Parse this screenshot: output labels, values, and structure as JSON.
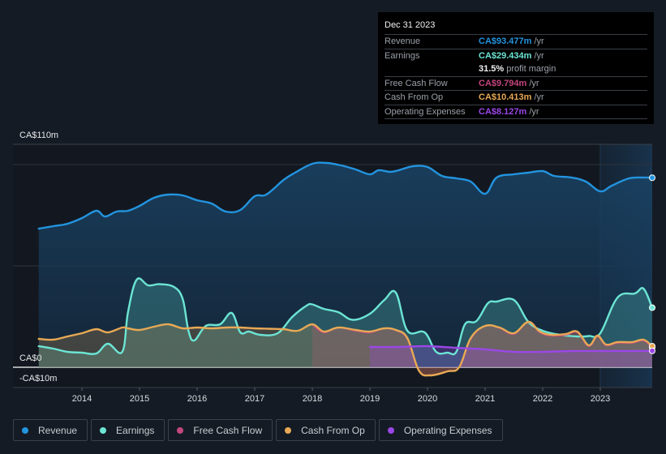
{
  "tooltip": {
    "date": "Dec 31 2023",
    "rows": [
      {
        "label": "Revenue",
        "value": "CA$93.477m",
        "unit": "/yr",
        "color": "#2394df"
      },
      {
        "label": "Earnings",
        "value": "CA$29.434m",
        "unit": "/yr",
        "color": "#6ce5d4"
      },
      {
        "label": "",
        "value": "31.5%",
        "unit": "profit margin",
        "color": "#f0f0f0"
      },
      {
        "label": "Free Cash Flow",
        "value": "CA$9.794m",
        "unit": "/yr",
        "color": "#c4467f"
      },
      {
        "label": "Cash From Op",
        "value": "CA$10.413m",
        "unit": "/yr",
        "color": "#e8a955"
      },
      {
        "label": "Operating Expenses",
        "value": "CA$8.127m",
        "unit": "/yr",
        "color": "#9b47e6"
      }
    ]
  },
  "legend": [
    {
      "label": "Revenue",
      "color": "#2394df"
    },
    {
      "label": "Earnings",
      "color": "#6ce5d4"
    },
    {
      "label": "Free Cash Flow",
      "color": "#c4467f"
    },
    {
      "label": "Cash From Op",
      "color": "#e8a955"
    },
    {
      "label": "Operating Expenses",
      "color": "#9b47e6"
    }
  ],
  "chart_data": {
    "type": "area",
    "title": "",
    "xlabel": "",
    "ylabel": "",
    "y_tick_labels": [
      "CA$110m",
      "CA$0",
      "-CA$10m"
    ],
    "ylim": [
      -10,
      110
    ],
    "xlim": [
      2013.25,
      2023.99
    ],
    "x_tick_labels": [
      "2014",
      "2015",
      "2016",
      "2017",
      "2018",
      "2019",
      "2020",
      "2021",
      "2022",
      "2023"
    ],
    "x_ticks": [
      2014,
      2015,
      2016,
      2017,
      2018,
      2019,
      2020,
      2021,
      2022,
      2023
    ],
    "gridlines_y": [
      50,
      100
    ],
    "highlight_from": 2023.0,
    "grid": true,
    "legend_position": "bottom",
    "series": [
      {
        "name": "Revenue",
        "color": "#2394df",
        "x": [
          2013.25,
          2013.5,
          2013.75,
          2014.0,
          2014.25,
          2014.4,
          2014.6,
          2014.8,
          2015.0,
          2015.25,
          2015.5,
          2015.75,
          2016.0,
          2016.25,
          2016.5,
          2016.75,
          2017.0,
          2017.2,
          2017.5,
          2017.7,
          2018.0,
          2018.25,
          2018.5,
          2018.75,
          2019.0,
          2019.15,
          2019.35,
          2019.5,
          2019.75,
          2020.0,
          2020.25,
          2020.5,
          2020.75,
          2021.0,
          2021.2,
          2021.5,
          2021.75,
          2022.0,
          2022.2,
          2022.5,
          2022.75,
          2023.0,
          2023.2,
          2023.5,
          2023.75,
          2023.9
        ],
        "values": [
          68.4,
          69.6,
          70.8,
          73.6,
          77.2,
          74.4,
          76.8,
          77.2,
          79.6,
          83.6,
          85.2,
          84.8,
          82.4,
          80.8,
          76.8,
          77.6,
          84.4,
          85.2,
          92.4,
          96.0,
          100.4,
          100.8,
          99.6,
          97.6,
          95.2,
          97.2,
          96.4,
          97.2,
          99.2,
          98.8,
          94.4,
          93.2,
          91.6,
          85.6,
          93.6,
          95.2,
          96.0,
          96.8,
          94.4,
          93.6,
          91.6,
          86.8,
          89.6,
          93.2,
          93.6,
          93.5
        ]
      },
      {
        "name": "Earnings",
        "color": "#6ce5d4",
        "x": [
          2013.25,
          2013.5,
          2013.75,
          2014.0,
          2014.25,
          2014.45,
          2014.7,
          2014.8,
          2014.95,
          2015.15,
          2015.35,
          2015.6,
          2015.75,
          2015.85,
          2015.95,
          2016.15,
          2016.4,
          2016.6,
          2016.75,
          2016.9,
          2017.1,
          2017.4,
          2017.65,
          2017.9,
          2018.0,
          2018.2,
          2018.45,
          2018.7,
          2019.0,
          2019.25,
          2019.45,
          2019.65,
          2019.95,
          2020.15,
          2020.35,
          2020.5,
          2020.65,
          2020.85,
          2021.05,
          2021.2,
          2021.5,
          2021.75,
          2022.0,
          2022.3,
          2022.6,
          2022.8,
          2023.0,
          2023.3,
          2023.6,
          2023.75,
          2023.9
        ],
        "values": [
          10.4,
          9.2,
          7.6,
          7.2,
          6.8,
          11.6,
          7.6,
          27.2,
          43.2,
          40.4,
          41.0,
          39.6,
          33.6,
          18.0,
          13.2,
          20.4,
          21.2,
          26.8,
          17.2,
          17.6,
          16.0,
          16.8,
          24.8,
          30.4,
          31.0,
          28.8,
          27.2,
          23.4,
          26.4,
          33.2,
          36.8,
          18.0,
          17.2,
          7.6,
          7.2,
          7.6,
          21.2,
          22.8,
          31.6,
          32.4,
          33.2,
          22.4,
          18.0,
          16.0,
          15.2,
          15.4,
          16.8,
          34.4,
          36.4,
          38.8,
          29.4
        ]
      },
      {
        "name": "Free Cash Flow",
        "color": "#c4467f",
        "x": [
          2018.0,
          2018.2,
          2018.45,
          2018.75,
          2019.0,
          2019.25,
          2019.45,
          2019.65,
          2019.85,
          2020.05,
          2020.35,
          2020.55,
          2020.75,
          2021.0,
          2021.25,
          2021.5,
          2021.75,
          2021.95,
          2022.15,
          2022.4,
          2022.6,
          2022.8,
          2022.95,
          2023.1,
          2023.3,
          2023.55,
          2023.75,
          2023.9
        ],
        "values": [
          21.2,
          17.2,
          19.6,
          18.0,
          17.2,
          19.2,
          18.2,
          14.0,
          -1.6,
          -4.0,
          -2.0,
          0.0,
          14.0,
          20.4,
          19.4,
          16.4,
          22.4,
          17.2,
          15.6,
          16.0,
          17.2,
          10.4,
          15.2,
          10.8,
          12.0,
          12.0,
          13.2,
          9.8
        ]
      },
      {
        "name": "Cash From Op",
        "color": "#e8a955",
        "x": [
          2013.25,
          2013.5,
          2013.75,
          2014.0,
          2014.25,
          2014.45,
          2014.7,
          2014.8,
          2015.0,
          2015.25,
          2015.5,
          2015.75,
          2016.0,
          2016.25,
          2016.5,
          2016.75,
          2017.0,
          2017.25,
          2017.5,
          2017.75,
          2018.0,
          2018.2,
          2018.45,
          2018.75,
          2019.0,
          2019.25,
          2019.45,
          2019.65,
          2019.85,
          2020.05,
          2020.35,
          2020.55,
          2020.75,
          2021.0,
          2021.25,
          2021.5,
          2021.75,
          2021.95,
          2022.15,
          2022.4,
          2022.6,
          2022.8,
          2022.95,
          2023.1,
          2023.3,
          2023.55,
          2023.75,
          2023.9
        ],
        "values": [
          14.0,
          13.6,
          15.2,
          16.8,
          18.8,
          17.2,
          19.6,
          19.2,
          18.4,
          20.0,
          21.2,
          19.2,
          19.6,
          19.2,
          19.6,
          19.6,
          19.2,
          19.0,
          18.8,
          18.0,
          21.2,
          17.6,
          19.6,
          18.4,
          17.6,
          19.2,
          18.4,
          14.4,
          -1.6,
          -4.0,
          -2.0,
          0.0,
          14.4,
          20.4,
          19.6,
          16.8,
          22.4,
          17.6,
          16.0,
          16.4,
          17.6,
          10.8,
          15.6,
          11.2,
          12.4,
          12.4,
          13.6,
          10.4
        ]
      },
      {
        "name": "Operating Expenses",
        "color": "#9b47e6",
        "x": [
          2019.0,
          2019.5,
          2020.0,
          2020.5,
          2021.0,
          2021.5,
          2022.0,
          2022.5,
          2023.0,
          2023.5,
          2023.9
        ],
        "values": [
          10.0,
          10.0,
          10.4,
          9.6,
          8.8,
          7.6,
          7.6,
          8.0,
          8.0,
          8.0,
          8.1
        ]
      }
    ]
  }
}
